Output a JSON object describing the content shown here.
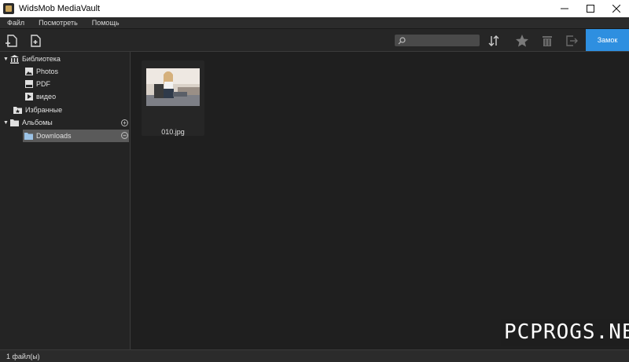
{
  "window": {
    "title": "WidsMob MediaVault"
  },
  "menu": {
    "items": [
      "Файл",
      "Посмотреть",
      "Помощь"
    ]
  },
  "toolbar": {
    "add_file_icon": "add-file-icon",
    "import_icon": "import-icon",
    "search": {
      "value": "",
      "placeholder": ""
    },
    "lock_label": "Замок"
  },
  "sidebar": {
    "library_label": "Библиотека",
    "library_items": [
      "Photos",
      "PDF",
      "видео"
    ],
    "favorites_label": "Избранные",
    "albums_label": "Альбомы",
    "albums": [
      "Downloads"
    ]
  },
  "content": {
    "files": [
      {
        "name": "010.jpg"
      }
    ]
  },
  "watermark": "PCPROGS.NET",
  "status": {
    "text": "1 файл(ы)"
  },
  "colors": {
    "accent": "#2e8fe0",
    "background": "#1f1f1f",
    "selection": "#5a5a5a"
  }
}
